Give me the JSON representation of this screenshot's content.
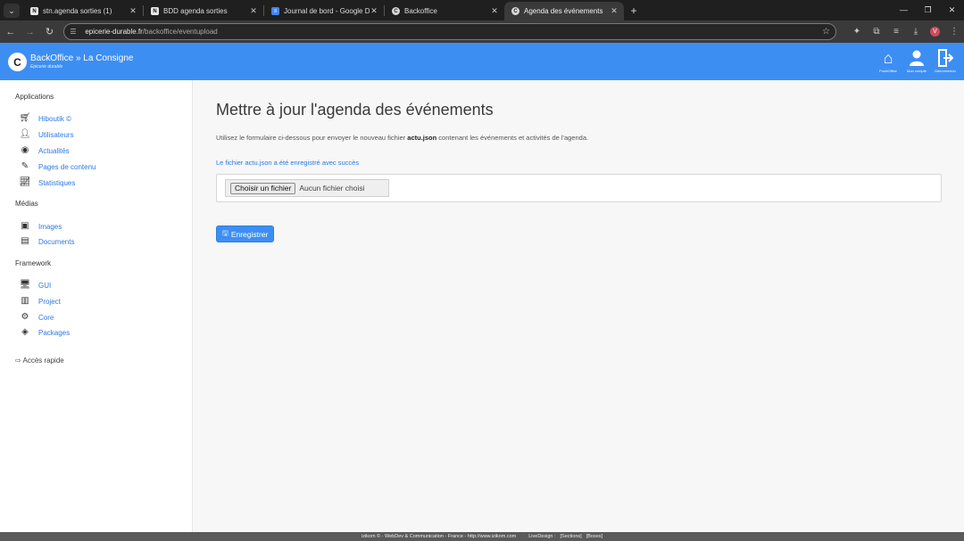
{
  "browser": {
    "tabs": [
      {
        "title": "stn.agenda sorties (1)",
        "favicon": "notion-icon",
        "fav_text": "N"
      },
      {
        "title": "BDD agenda sorties",
        "favicon": "notion-icon",
        "fav_text": "N"
      },
      {
        "title": "Journal de bord - Google Docs",
        "favicon": "docs-icon",
        "fav_text": "≡"
      },
      {
        "title": "Backoffice",
        "favicon": "backoffice-icon",
        "fav_text": "C"
      },
      {
        "title": "Agenda des événements",
        "favicon": "backoffice-icon",
        "fav_text": "C"
      }
    ],
    "active_tab": 4,
    "url_host": "epicerie-durable.fr",
    "url_path": "/backoffice/eventupload",
    "profile_initial": "V"
  },
  "header": {
    "logo_text": "C",
    "title": "BackOffice » La Consigne",
    "subtitle": "Epicerie durable",
    "links": [
      {
        "label": "FrontOffice",
        "icon": "home-icon"
      },
      {
        "label": "Mon compte",
        "icon": "user-icon"
      },
      {
        "label": "Déconnexion",
        "icon": "logout-icon"
      }
    ]
  },
  "sidebar": {
    "sections": [
      {
        "title": "Applications",
        "items": [
          {
            "label": "Hiboutik ©",
            "icon": "cart-icon"
          },
          {
            "label": "Utilisateurs",
            "icon": "users-icon"
          },
          {
            "label": "Actualités",
            "icon": "rss-icon"
          },
          {
            "label": "Pages de contenu",
            "icon": "edit-icon"
          },
          {
            "label": "Statistiques",
            "icon": "chart-icon"
          }
        ]
      },
      {
        "title": "Médias",
        "items": [
          {
            "label": "Images",
            "icon": "image-icon"
          },
          {
            "label": "Documents",
            "icon": "document-icon"
          }
        ]
      },
      {
        "title": "Framework",
        "items": [
          {
            "label": "GUI",
            "icon": "monitor-icon"
          },
          {
            "label": "Project",
            "icon": "books-icon"
          },
          {
            "label": "Core",
            "icon": "cogs-icon"
          },
          {
            "label": "Packages",
            "icon": "layers-icon"
          }
        ]
      }
    ],
    "quick_access": "⇨ Accès rapide"
  },
  "main": {
    "title": "Mettre à jour l'agenda des événements",
    "intro_before": "Utilisez le formulaire ci-dessous pour envoyer le nouveau fichier ",
    "intro_file": "actu.json",
    "intro_after": " contenant les événements et activités de l'agenda.",
    "success": "Le fichier actu.json a été enregistré avec succès",
    "file_button": "Choisir un fichier",
    "file_none": "Aucun fichier choisi",
    "save_label": "Enregistrer"
  },
  "footer": {
    "credit": "izikom © - WebDev & Communication - France - http://www.izikom.com",
    "live": "LiveDesign :",
    "sections": "[Sections]",
    "boxes": "[Boxes]"
  }
}
